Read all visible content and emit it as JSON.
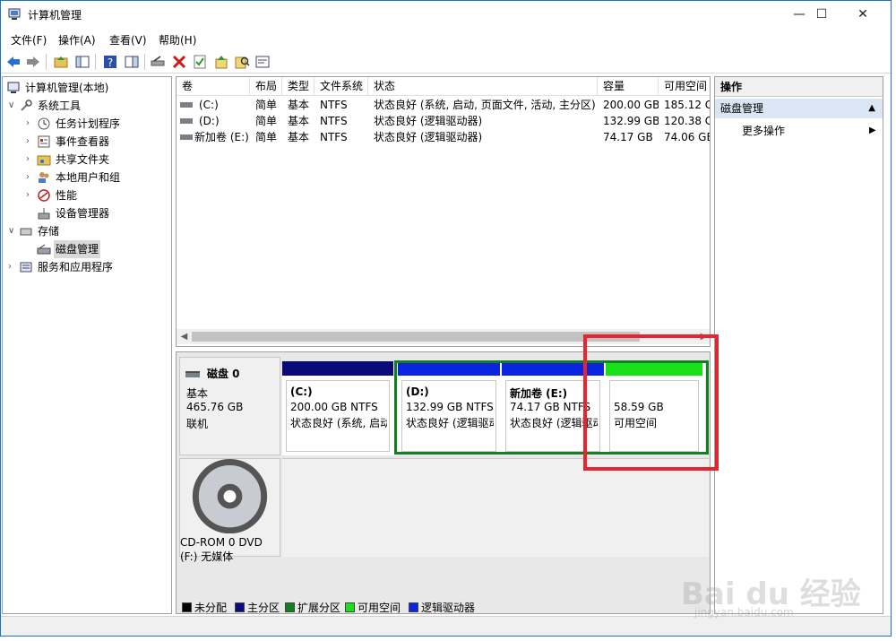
{
  "window": {
    "title": "计算机管理"
  },
  "window_controls": {
    "minimize": "—",
    "maximize": "☐",
    "close": "✕"
  },
  "menu": [
    "文件(F)",
    "操作(A)",
    "查看(V)",
    "帮助(H)"
  ],
  "tree": {
    "root": "计算机管理(本地)",
    "system_tools": "系统工具",
    "task_scheduler": "任务计划程序",
    "event_viewer": "事件查看器",
    "shared_folders": "共享文件夹",
    "local_users": "本地用户和组",
    "performance": "性能",
    "device_manager": "设备管理器",
    "storage": "存储",
    "disk_management": "磁盘管理",
    "services": "服务和应用程序"
  },
  "volumes": {
    "headers": [
      "卷",
      "布局",
      "类型",
      "文件系统",
      "状态",
      "容量",
      "可用空间"
    ],
    "rows": [
      [
        "(C:)",
        "简单",
        "基本",
        "NTFS",
        "状态良好 (系统, 启动, 页面文件, 活动, 主分区)",
        "200.00 GB",
        "185.12 G"
      ],
      [
        "(D:)",
        "简单",
        "基本",
        "NTFS",
        "状态良好 (逻辑驱动器)",
        "132.99 GB",
        "120.38 G"
      ],
      [
        "新加卷 (E:)",
        "简单",
        "基本",
        "NTFS",
        "状态良好 (逻辑驱动器)",
        "74.17 GB",
        "74.06 GB"
      ]
    ]
  },
  "disk0": {
    "name": "磁盘 0",
    "type": "基本",
    "size": "465.76 GB",
    "status": "联机",
    "partitions": [
      {
        "name": "(C:)",
        "size": "200.00 GB NTFS",
        "status": "状态良好 (系统, 启动",
        "color": "#0a0a7a"
      },
      {
        "name": "(D:)",
        "size": "132.99 GB NTFS",
        "status": "状态良好 (逻辑驱动",
        "color": "#0a24e0"
      },
      {
        "name": "新加卷  (E:)",
        "size": "74.17 GB NTFS",
        "status": "状态良好 (逻辑驱动",
        "color": "#0a24e0"
      },
      {
        "name": "",
        "size": "58.59 GB",
        "status": "可用空间",
        "color": "#18e018"
      }
    ]
  },
  "cdrom": {
    "name": "CD-ROM 0",
    "type": "DVD (F:)",
    "status": "无媒体"
  },
  "legend": [
    {
      "label": "未分配",
      "color": "#000000"
    },
    {
      "label": "主分区",
      "color": "#0a0a7a"
    },
    {
      "label": "扩展分区",
      "color": "#12801e"
    },
    {
      "label": "可用空间",
      "color": "#18e018"
    },
    {
      "label": "逻辑驱动器",
      "color": "#0a24e0"
    }
  ],
  "actions": {
    "header": "操作",
    "section": "磁盘管理",
    "more": "更多操作"
  },
  "watermark": {
    "brand": "Bai du 经验",
    "url": "jingyan.baidu.com"
  }
}
